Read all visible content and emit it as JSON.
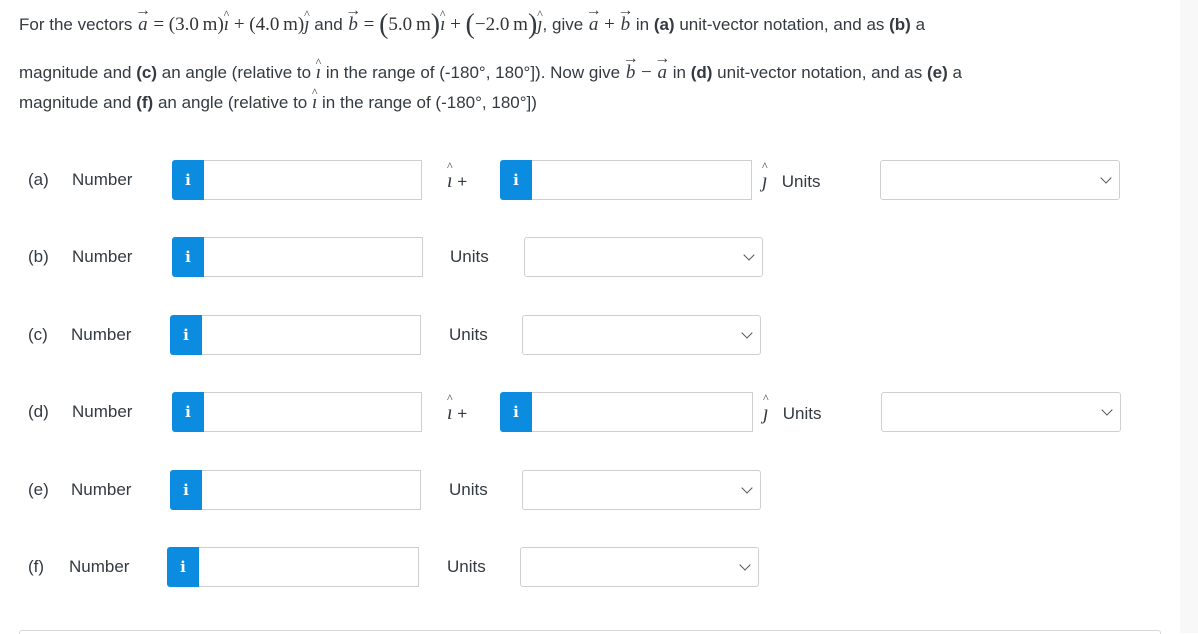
{
  "question": {
    "intro": "For the vectors",
    "vec_a": "a",
    "vec_b": "b",
    "eq": "=",
    "a_i_coef": "(3.0 m)",
    "plus": "+",
    "a_j_coef": "(4.0 m)",
    "and": "and",
    "b_i_coef": "5.0 m",
    "b_j_coef": "−2.0 m",
    "i_hat": "ı",
    "j_hat": "ȷ",
    "give": ", give",
    "in_text": "in",
    "part_a_tag": "(a)",
    "line1_tail_1": "unit-vector notation, and as",
    "part_b_tag": "(b)",
    "line1_tail_2": "a",
    "line2_head": "magnitude and",
    "part_c_tag": "(c)",
    "angle_text": "an angle (relative to",
    "range_text": "in the range of (-180°, 180°]). Now give",
    "minus": "−",
    "part_d_tag": "(d)",
    "line2_tail_1": "unit-vector notation, and as",
    "part_e_tag": "(e)",
    "line2_tail_2": "a",
    "line3_head": "magnitude and",
    "part_f_tag": "(f)",
    "range_text_end": "in the range of (-180°, 180°])"
  },
  "rows": [
    {
      "label": "(a)",
      "number_label": "Number",
      "value1": "",
      "i_plus": "+",
      "value2": "",
      "j_units": "Units",
      "units_value": ""
    },
    {
      "label": "(b)",
      "number_label": "Number",
      "value": "",
      "units_label": "Units",
      "units_value": ""
    },
    {
      "label": "(c)",
      "number_label": "Number",
      "value": "",
      "units_label": "Units",
      "units_value": ""
    },
    {
      "label": "(d)",
      "number_label": "Number",
      "value1": "",
      "i_plus": "+",
      "value2": "",
      "j_units": "Units",
      "units_value": ""
    },
    {
      "label": "(e)",
      "number_label": "Number",
      "value": "",
      "units_label": "Units",
      "units_value": ""
    },
    {
      "label": "(f)",
      "number_label": "Number",
      "value": "",
      "units_label": "Units",
      "units_value": ""
    }
  ],
  "info_icon": "i",
  "icons": {
    "info": "info-icon",
    "dropdown": "chevron-down-icon"
  },
  "colors": {
    "info_button": "#0b8ce0",
    "text": "#333a41",
    "border": "#cfcfcf",
    "side_strip": "#f8f8f8"
  }
}
